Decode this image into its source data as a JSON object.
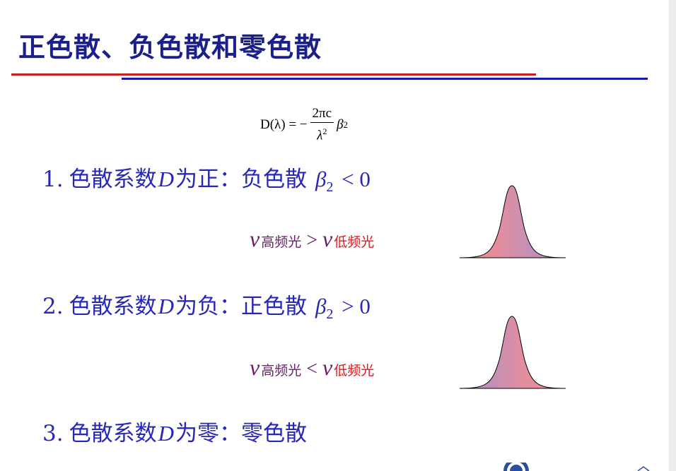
{
  "slide": {
    "title": "正色散、负色散和零色散",
    "formula": {
      "lhs": "D(λ) = −",
      "numerator": "2πc",
      "denominator_base": "λ",
      "denominator_exp": "2",
      "beta": "β",
      "beta_sub": "2"
    },
    "items": [
      {
        "number": "1.",
        "prefix": "色散系数",
        "symbol": "D",
        "suffix": "为正：负色散",
        "beta": "β",
        "beta_sub": "2",
        "relation": "< 0"
      },
      {
        "number": "2.",
        "prefix": "色散系数",
        "symbol": "D",
        "suffix": "为负：正色散",
        "beta": "β",
        "beta_sub": "2",
        "relation": "> 0"
      },
      {
        "number": "3.",
        "prefix": "色散系数",
        "symbol": "D",
        "suffix": "为零：零色散"
      }
    ],
    "relations": [
      {
        "nu": "ν",
        "left_sub": "高频光",
        "operator": ">",
        "right_sub": "低频光"
      },
      {
        "nu": "ν",
        "left_sub": "高频光",
        "operator": "<",
        "right_sub": "低频光"
      }
    ],
    "colors": {
      "title": "#1b1f8a",
      "body_text": "#2727b8",
      "line_red": "#c82020",
      "line_blue": "#1a1aa0",
      "high_freq": "#6a1b6a",
      "low_freq": "#e0151a",
      "pulse_red": "#ef8a8f",
      "pulse_blue": "#a98fc0"
    }
  }
}
